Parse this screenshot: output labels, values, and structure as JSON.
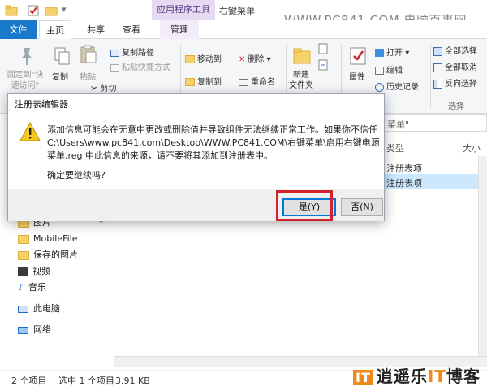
{
  "titlebar": {
    "context_tab_label": "应用程序工具",
    "window_title": "右键菜单",
    "watermark": "WWW.PC841.COM 电脑百事网"
  },
  "menu_tabs": {
    "file": "文件",
    "home": "主页",
    "share": "共享",
    "view": "查看",
    "manage": "管理"
  },
  "ribbon": {
    "pin_quick_access": "固定到\"快速访问\"",
    "copy": "复制",
    "paste": "粘贴",
    "copy_path": "复制路径",
    "paste_shortcut": "粘贴快捷方式",
    "cut": "剪切",
    "move_to": "移动到",
    "copy_to": "复制到",
    "delete": "删除",
    "rename": "重命名",
    "new_folder": "新建\n文件夹",
    "properties": "属性",
    "open": "打开",
    "edit": "编辑",
    "history": "历史记录",
    "select_all": "全部选择",
    "select_none": "全部取消",
    "invert_selection": "反向选择",
    "select_group": "选择"
  },
  "file_area": {
    "search_text": "菜单\"",
    "col_type": "类型",
    "col_size": "大小",
    "rows": [
      "注册表项",
      "注册表项"
    ]
  },
  "navigation": {
    "items": [
      "图片",
      "MobileFile",
      "保存的图片",
      "视频",
      "音乐",
      "此电脑",
      "网络"
    ]
  },
  "status_bar": {
    "item_count": "2 个项目",
    "selected": "选中 1 个项目",
    "size": "3.91 KB"
  },
  "brand": {
    "it_badge": "IT",
    "text_a": "逍遥乐",
    "text_b": "IT",
    "text_c": "博客"
  },
  "dialog": {
    "title": "注册表编辑器",
    "message": "添加信息可能会在无意中更改或删除值并导致组件无法继续正常工作。如果你不信任 C:\\Users\\www.pc841.com\\Desktop\\WWW.PC841.COM\\右键菜单\\启用右键电源菜单.reg 中此信息的来源，请不要将其添加到注册表中。",
    "question": "确定要继续吗?",
    "yes_label": "是(Y)",
    "no_label": "否(N)"
  },
  "colors": {
    "file_tab": "#1979ca",
    "context_tab": "#e6d9f2",
    "highlight_box": "#d2232a",
    "brand_accent": "#f08a1c"
  }
}
